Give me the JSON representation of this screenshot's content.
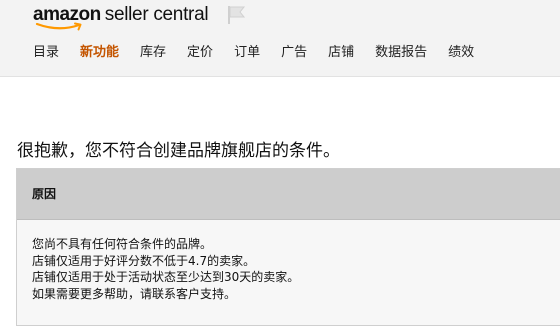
{
  "header": {
    "logo_amazon": "amazon",
    "logo_sellercentral": "seller central"
  },
  "nav": {
    "items": [
      {
        "label": "目录"
      },
      {
        "label": "新功能",
        "highlight": true
      },
      {
        "label": "库存"
      },
      {
        "label": "定价"
      },
      {
        "label": "订单"
      },
      {
        "label": "广告"
      },
      {
        "label": "店铺"
      },
      {
        "label": "数据报告"
      },
      {
        "label": "绩效"
      }
    ]
  },
  "main": {
    "title": "很抱歉，您不符合创建品牌旗舰店的条件。",
    "reasons_header": "原因",
    "reasons": [
      "您尚不具有任何符合条件的品牌。",
      "店铺仅适用于好评分数不低于4.7的卖家。",
      "店铺仅适用于处于活动状态至少达到30天的卖家。",
      "如果需要更多帮助，请联系客户支持。"
    ]
  },
  "colors": {
    "accent": "#c45500",
    "smile": "#ff9900",
    "header_bg": "#f3f3f3",
    "reasons_header_bg": "#cdcdcd",
    "reasons_body_bg": "#f7f7f7"
  },
  "icons": {
    "logo_smile": "amazon-smile-icon",
    "flag": "flag-icon"
  }
}
